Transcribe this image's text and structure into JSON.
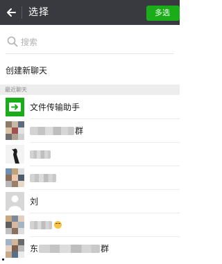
{
  "header": {
    "title": "选择",
    "multi_select_label": "多选"
  },
  "search": {
    "placeholder": "搜索"
  },
  "new_chat_label": "创建新聊天",
  "section": {
    "recent_label": "最近聊天"
  },
  "chats": [
    {
      "name": "文件传输助手",
      "avatar": "file-transfer-icon"
    },
    {
      "name_suffix": "群",
      "avatar": "group-mosaic"
    },
    {
      "name": "",
      "avatar": "photo"
    },
    {
      "name": "",
      "avatar": "group-mosaic"
    },
    {
      "name": "刘",
      "avatar": "default-person-icon"
    },
    {
      "name": "",
      "avatar": "group-mosaic",
      "trailing": "smile-emoji"
    },
    {
      "name_prefix": "东",
      "name_suffix": "群",
      "avatar": "group-mosaic"
    }
  ],
  "colors": {
    "topbar": "#393a3f",
    "accent_green": "#1aad19",
    "section_bg": "#ededed",
    "text_primary": "#1a1a1a",
    "text_placeholder": "#b2b2b2"
  }
}
